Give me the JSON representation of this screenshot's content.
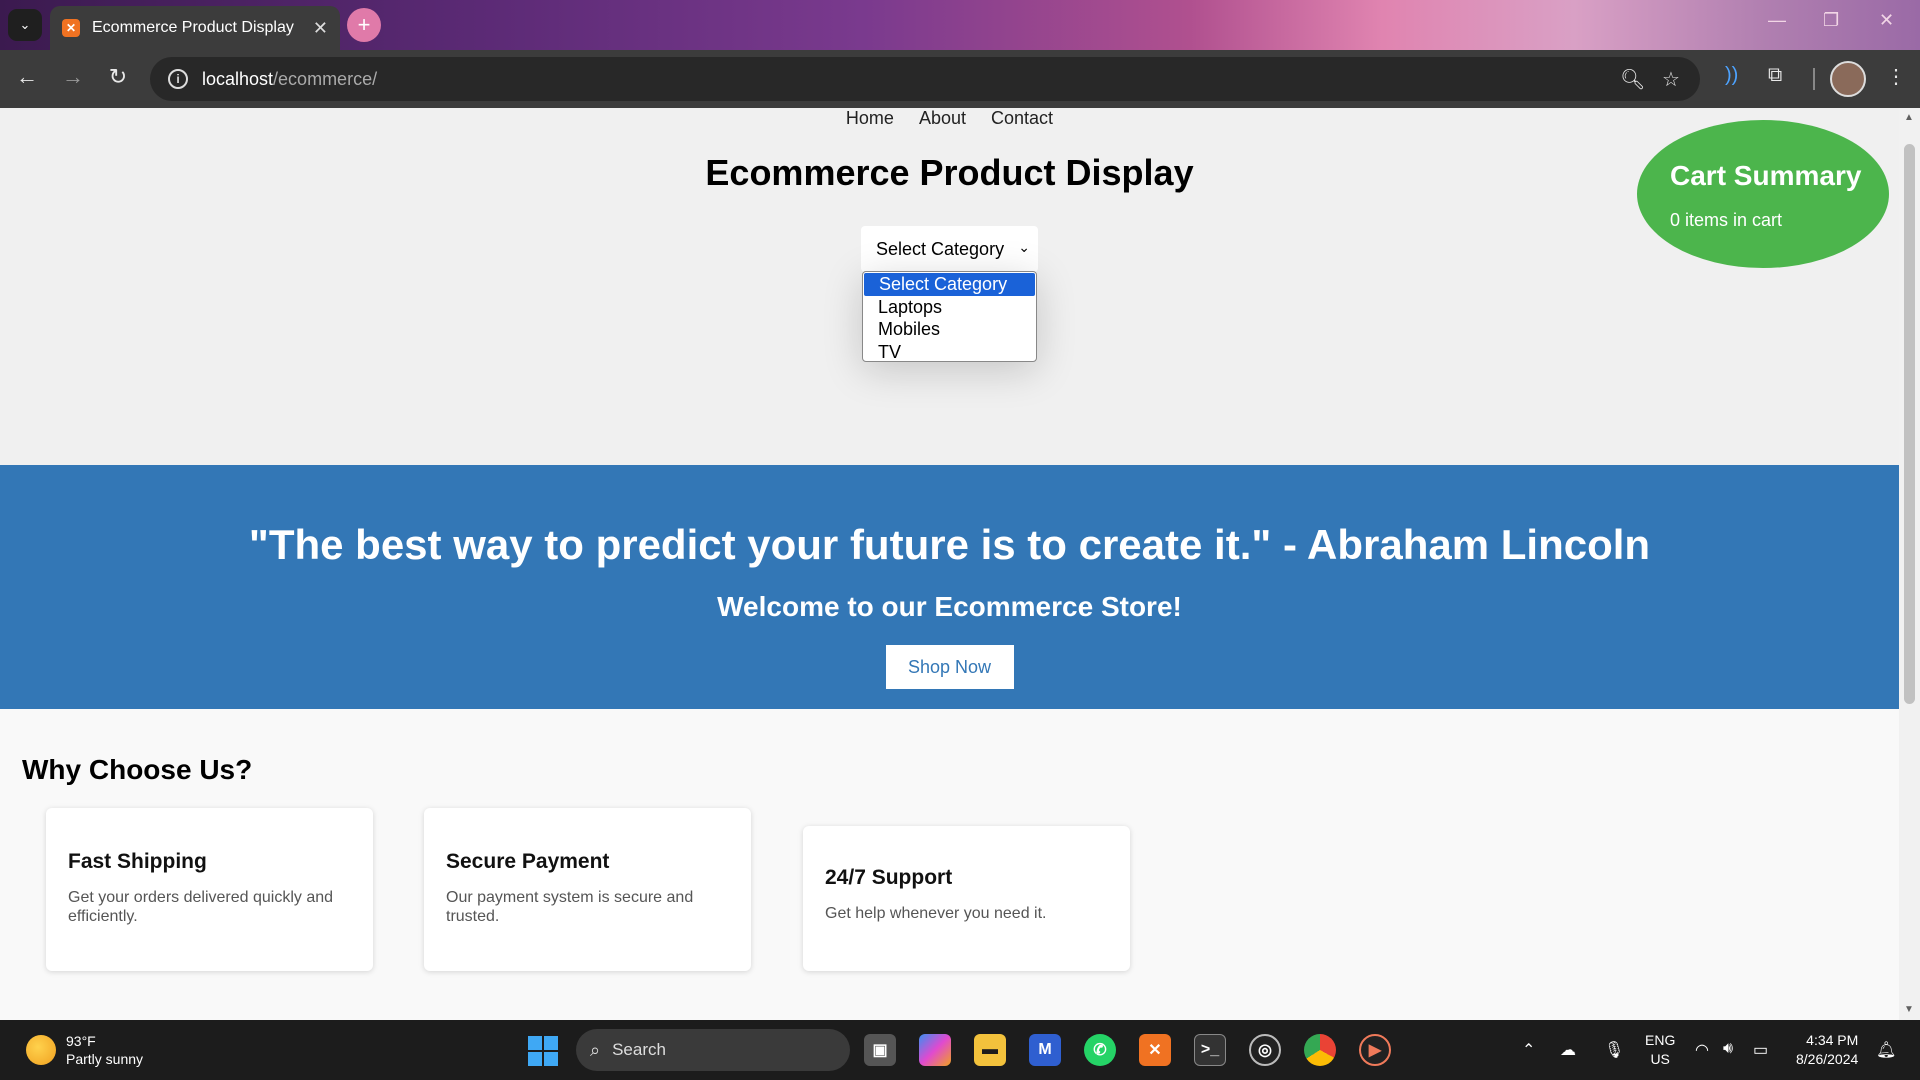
{
  "browser": {
    "tab_title": "Ecommerce Product Display",
    "url_host": "localhost",
    "url_path": "/ecommerce/"
  },
  "page": {
    "nav": [
      "Home",
      "About",
      "Contact"
    ],
    "title": "Ecommerce Product Display",
    "category_select": {
      "selected": "Select Category",
      "options": [
        "Select Category",
        "Laptops",
        "Mobiles",
        "TV"
      ]
    },
    "cart": {
      "title": "Cart Summary",
      "count_text": "0 items in cart"
    },
    "hero": {
      "quote": "\"The best way to predict your future is to create it.\" - Abraham Lincoln",
      "welcome": "Welcome to our Ecommerce Store!",
      "button": "Shop Now"
    },
    "features": {
      "title": "Why Choose Us?",
      "cards": [
        {
          "title": "Fast Shipping",
          "desc": "Get your orders delivered quickly and efficiently."
        },
        {
          "title": "Secure Payment",
          "desc": "Our payment system is secure and trusted."
        },
        {
          "title": "24/7 Support",
          "desc": "Get help whenever you need it."
        }
      ]
    }
  },
  "taskbar": {
    "weather_temp": "93°F",
    "weather_desc": "Partly sunny",
    "search_placeholder": "Search",
    "lang_top": "ENG",
    "lang_bottom": "US",
    "time": "4:34 PM",
    "date": "8/26/2024"
  },
  "colors": {
    "hero_bg": "#3377b6",
    "cart_bg": "#4cb54c",
    "select_highlight": "#1a62d8"
  }
}
